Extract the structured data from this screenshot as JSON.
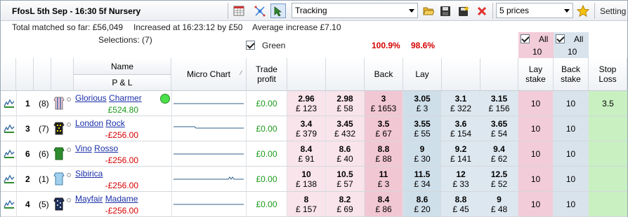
{
  "toolbar": {
    "title": "FfosL  5th Sep - 16:30 5f Nursery",
    "mode_value": "Tracking",
    "prices_value": "5 prices",
    "settings_label": "Setting"
  },
  "info": {
    "total_matched": "Total matched so far: £56,049",
    "increased": "Increased at 16:23:12 by £50",
    "avg_increase": "Average increase £7.10",
    "selections": "Selections: (7)",
    "green_label": "Green",
    "book_back": "100.9%",
    "book_lay": "98.6%",
    "all_lay_label": "All",
    "all_lay_value": "10",
    "all_back_label": "All",
    "all_back_value": "10"
  },
  "headers": {
    "name": "Name",
    "pnl": "P & L",
    "micro_chart": "Micro Chart",
    "trade_profit_1": "Trade",
    "trade_profit_2": "profit",
    "back": "Back",
    "lay": "Lay",
    "lay_stake_1": "Lay",
    "lay_stake_2": "stake",
    "back_stake_1": "Back",
    "back_stake_2": "stake",
    "stop_loss_1": "Stop",
    "stop_loss_2": "Loss"
  },
  "runners": [
    {
      "num": "1",
      "stall": "(8)",
      "name1": "Glorious",
      "name2": "Charmer",
      "pnl": "£524.80",
      "pnl_positive": true,
      "trade": "£0.00",
      "backs": [
        [
          "2.96",
          "£ 123"
        ],
        [
          "2.98",
          "£ 58"
        ],
        [
          "3",
          "£ 1653"
        ]
      ],
      "lays": [
        [
          "3.05",
          "£ 3"
        ],
        [
          "3.1",
          "£ 322"
        ],
        [
          "3.15",
          "£ 156"
        ]
      ],
      "lay_stake": "10",
      "back_stake": "10",
      "stop_loss": "3.5",
      "silk": "stripes-pink"
    },
    {
      "num": "3",
      "stall": "(7)",
      "name1": "London",
      "name2": "Rock",
      "pnl": "-£256.00",
      "pnl_positive": false,
      "trade": "£0.00",
      "backs": [
        [
          "3.4",
          "£ 379"
        ],
        [
          "3.45",
          "£ 432"
        ],
        [
          "3.5",
          "£ 67"
        ]
      ],
      "lays": [
        [
          "3.55",
          "£ 55"
        ],
        [
          "3.6",
          "£ 154"
        ],
        [
          "3.65",
          "£ 54"
        ]
      ],
      "lay_stake": "10",
      "back_stake": "10",
      "stop_loss": "",
      "silk": "check-black"
    },
    {
      "num": "6",
      "stall": "(6)",
      "name1": "Vino",
      "name2": "Rosso",
      "pnl": "-£256.00",
      "pnl_positive": false,
      "trade": "£0.00",
      "backs": [
        [
          "8.4",
          "£ 91"
        ],
        [
          "8.6",
          "£ 40"
        ],
        [
          "8.8",
          "£ 88"
        ]
      ],
      "lays": [
        [
          "9",
          "£ 30"
        ],
        [
          "9.2",
          "£ 141"
        ],
        [
          "9.4",
          "£ 62"
        ]
      ],
      "lay_stake": "10",
      "back_stake": "10",
      "stop_loss": "",
      "silk": "green"
    },
    {
      "num": "2",
      "stall": "(1)",
      "name1": "Sibirica",
      "name2": "",
      "pnl": "-£256.00",
      "pnl_positive": false,
      "trade": "£0.00",
      "backs": [
        [
          "10",
          "£ 138"
        ],
        [
          "10.5",
          "£ 57"
        ],
        [
          "11",
          "£ 3"
        ]
      ],
      "lays": [
        [
          "11.5",
          "£ 34"
        ],
        [
          "12",
          "£ 33"
        ],
        [
          "12.5",
          "£ 52"
        ]
      ],
      "lay_stake": "10",
      "back_stake": "10",
      "stop_loss": "",
      "silk": "lightblue"
    },
    {
      "num": "4",
      "stall": "(5)",
      "name1": "Mayfair",
      "name2": "Madame",
      "pnl": "-£256.00",
      "pnl_positive": false,
      "trade": "£0.00",
      "backs": [
        [
          "8",
          "£ 157"
        ],
        [
          "8.2",
          "£ 69"
        ],
        [
          "8.4",
          "£ 86"
        ]
      ],
      "lays": [
        [
          "8.6",
          "£ 20"
        ],
        [
          "8.8",
          "£ 45"
        ],
        [
          "9",
          "£ 48"
        ]
      ],
      "lay_stake": "10",
      "back_stake": "10",
      "stop_loss": "",
      "silk": "navy-spots"
    }
  ],
  "colors": {
    "back_best": "#f2c7d4",
    "back": "#f9e4eb",
    "lay_best": "#cfdfea",
    "lay": "#dde7ef",
    "green": "#1a9a1a",
    "red": "#d60000"
  }
}
